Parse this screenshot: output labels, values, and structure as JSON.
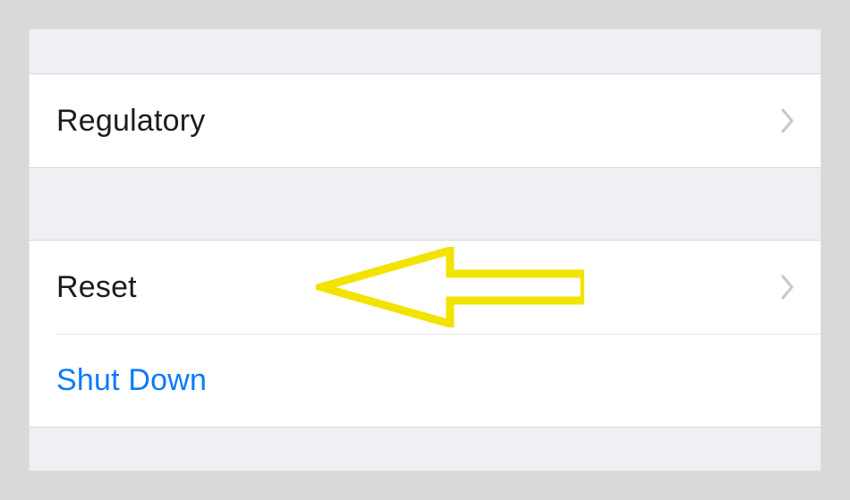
{
  "groups": [
    {
      "name": "legal",
      "rows": [
        {
          "name": "regulatory",
          "label": "Regulatory",
          "chevron": true,
          "link": false
        }
      ]
    },
    {
      "name": "system",
      "rows": [
        {
          "name": "reset",
          "label": "Reset",
          "chevron": true,
          "link": false,
          "highlight_arrow": true
        },
        {
          "name": "shut-down",
          "label": "Shut Down",
          "chevron": false,
          "link": true
        }
      ]
    }
  ],
  "annotation": {
    "arrow_color": "#f2e300"
  }
}
